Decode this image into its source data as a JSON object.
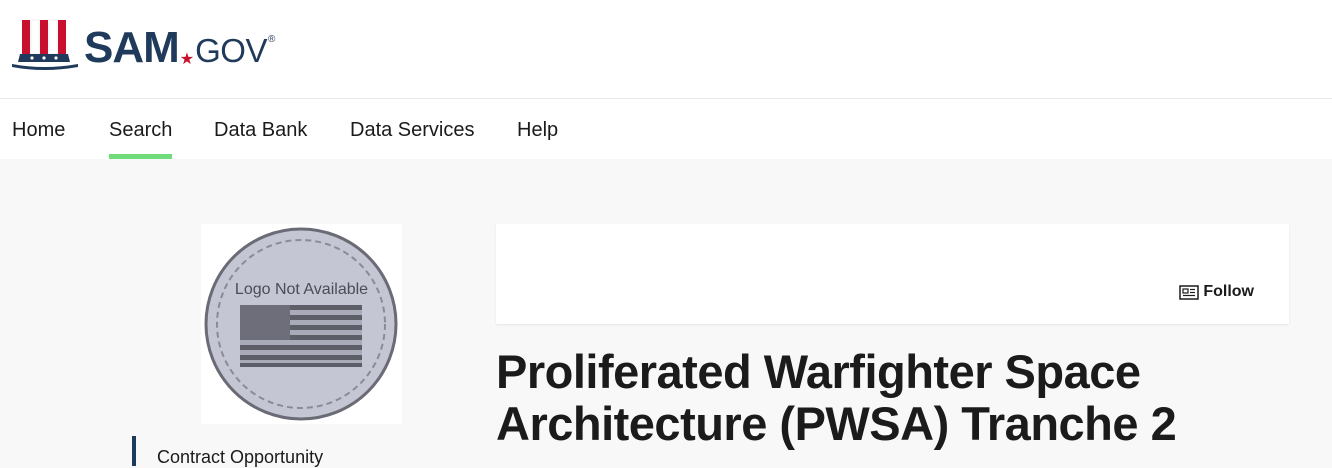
{
  "brand": {
    "name_primary": "SAM",
    "name_secondary": "GOV",
    "registered_mark": "®",
    "colors": {
      "navy": "#1f3a5a",
      "red": "#c8102e"
    },
    "icon": "uncle-sam-hat-icon"
  },
  "nav": {
    "items": [
      {
        "label": "Home",
        "active": false
      },
      {
        "label": "Search",
        "active": true
      },
      {
        "label": "Data Bank",
        "active": false
      },
      {
        "label": "Data Services",
        "active": false
      },
      {
        "label": "Help",
        "active": false
      }
    ],
    "active_indicator_color": "#6fdc7c"
  },
  "sidebar": {
    "logo_placeholder_text": "Logo Not Available",
    "logo_icon": "us-flag-seal-icon",
    "section_label": "Contract Opportunity"
  },
  "main": {
    "follow_label": "Follow",
    "follow_icon": "newspaper-icon",
    "title": "Proliferated Warfighter Space Architecture (PWSA) Tranche 2"
  }
}
